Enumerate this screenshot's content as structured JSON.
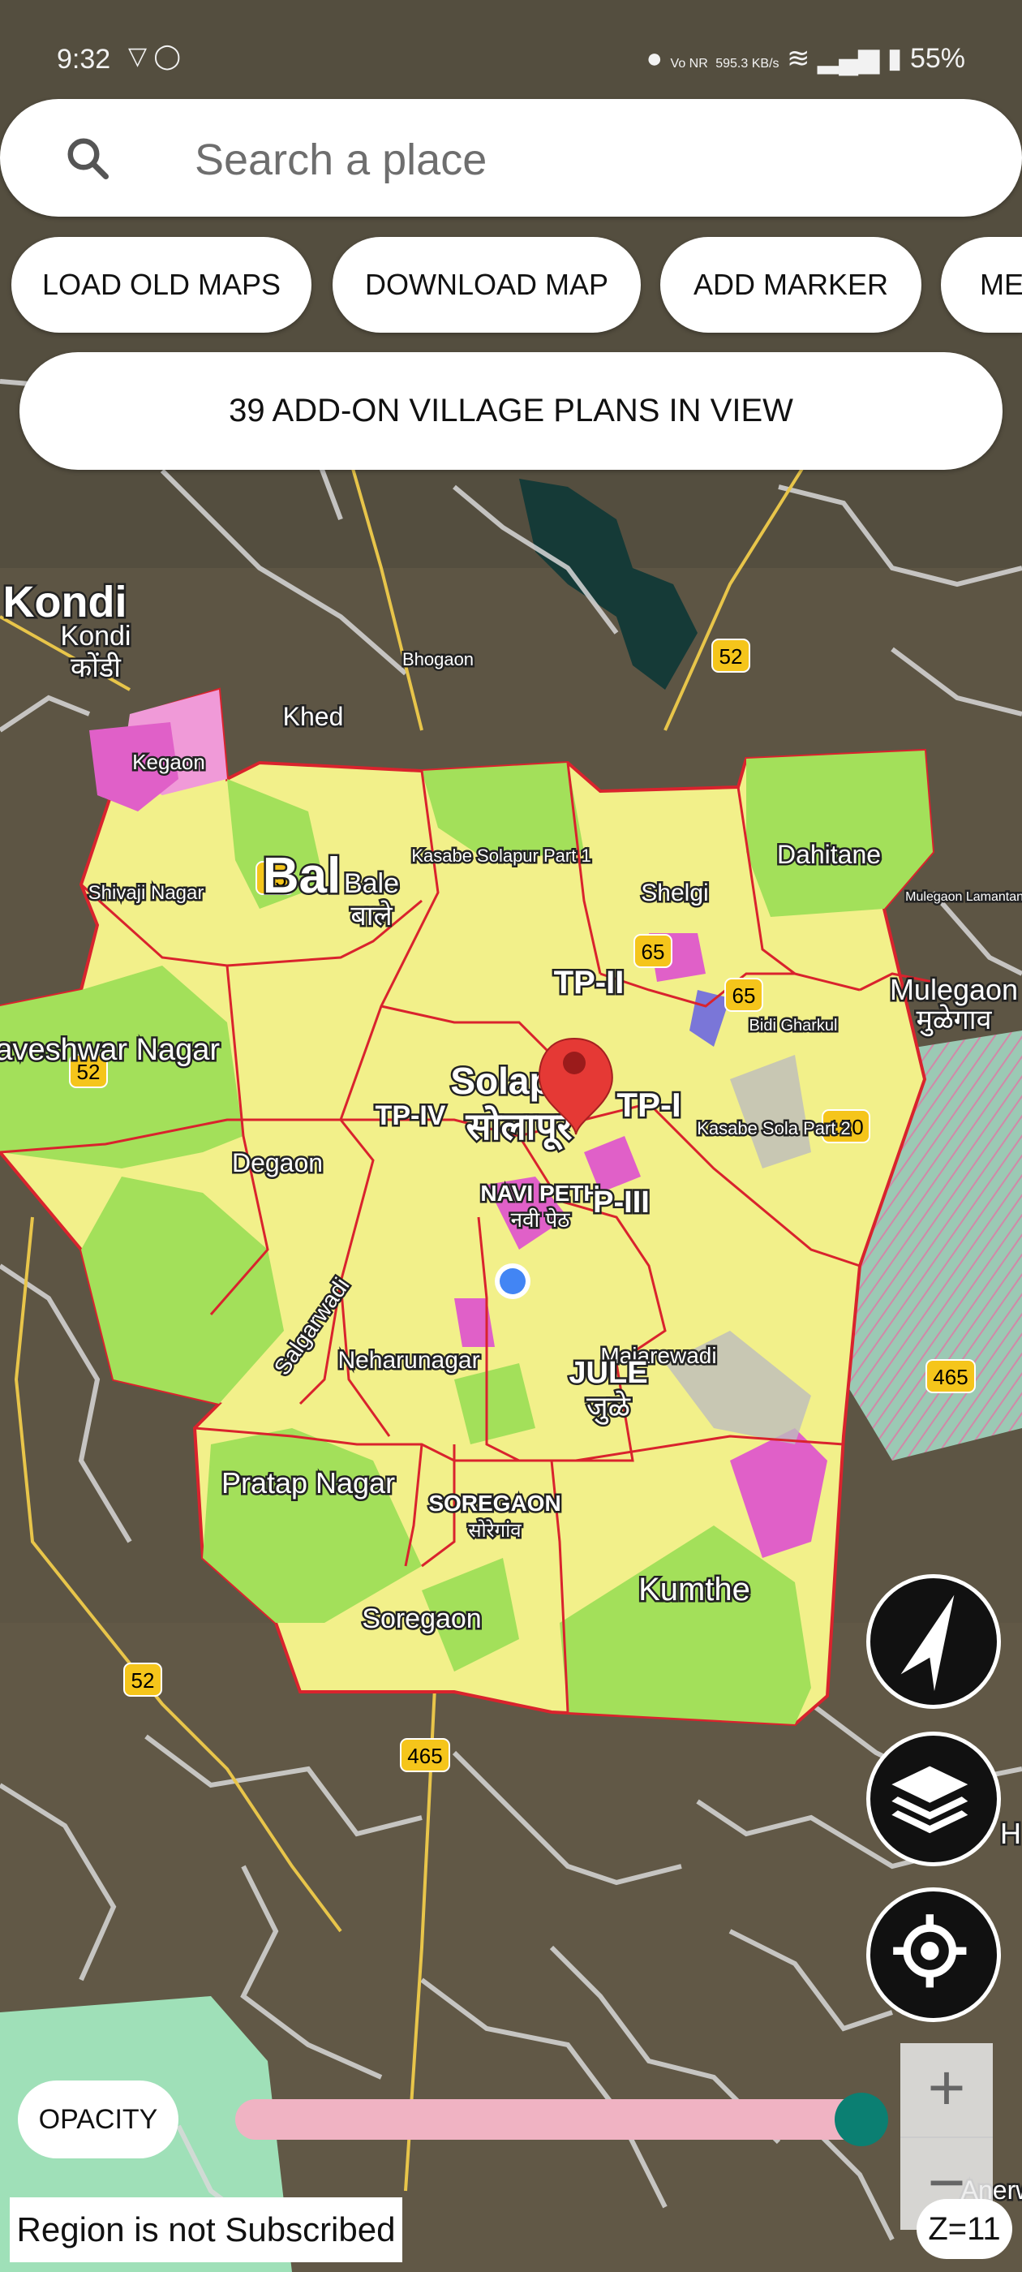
{
  "status_bar": {
    "time": "9:32",
    "network_speed": "595.3 KB/s",
    "network_label": "Vo NR",
    "battery": "55%"
  },
  "search": {
    "placeholder": "Search a place"
  },
  "chips": [
    "LOAD OLD MAPS",
    "DOWNLOAD MAP",
    "ADD MARKER",
    "ME"
  ],
  "banner": "39 ADD-ON VILLAGE PLANS IN VIEW",
  "map": {
    "place_labels": {
      "kondi_en": "Kondi",
      "kondi_en2": "Kondi",
      "kondi_mr": "कोंडी",
      "bhogaon": "Bhogaon",
      "khed": "Khed",
      "kegaon": "Kegaon",
      "kasabe_part1": "Kasabe Solapur Part 1",
      "shelgi": "Shelgi",
      "dahitane": "Dahitane",
      "mulegaon_lamantanda": "Mulegaon Lamantanda",
      "shivaji_nagar": "Shivaji Nagar",
      "bale_big": "Bal",
      "bale_en": "Bale",
      "bale_mr": "बाले",
      "tp2": "TP-II",
      "mulegaon_en": "Mulegaon",
      "mulegaon_mr": "मुळेगाव",
      "bidi_gharkul": "Bidi Gharkul",
      "basaveshwar": "Basaveshwar Nagar",
      "solapur_en": "Solap",
      "solapur_mr": "सोलापूर",
      "tp4": "TP-IV",
      "tp1": "TP-I",
      "kasabe_part2": "Kasabe Sola Part 2",
      "degaon": "Degaon",
      "navi_peth_en": "NAVI PETH",
      "navi_peth_mr": "नवी पेठ",
      "tp3": "P-III",
      "salgarwadi": "Salgarwadi",
      "neharunagar": "Neharunagar",
      "majarewadi": "Majarewadi",
      "jule_en": "JULE",
      "jule_mr": "जुळे",
      "pratap": "Pratap Nagar",
      "soregaon_caps": "SOREGAON",
      "soregaon_mr": "सोरेगांव",
      "kumthe": "Kumthe",
      "soregaon": "Soregaon",
      "h_edge": "H",
      "anerw": "Anerw"
    },
    "road_shields": [
      "52",
      "65",
      "65",
      "65",
      "52",
      "150",
      "465",
      "52",
      "465"
    ]
  },
  "controls": {
    "opacity_label": "OPACITY",
    "opacity_value": 0.97,
    "zoom_in": "+",
    "zoom_out": "−",
    "zoom_level": "Z=11",
    "region_notice": "Region is not Subscribed"
  },
  "colors": {
    "accent_teal": "#0b7f72",
    "slider_track": "#f0b3c3",
    "boundary_red": "#d9232d",
    "plan_yellow": "#f2f08a",
    "plan_green": "#a3e05a"
  }
}
